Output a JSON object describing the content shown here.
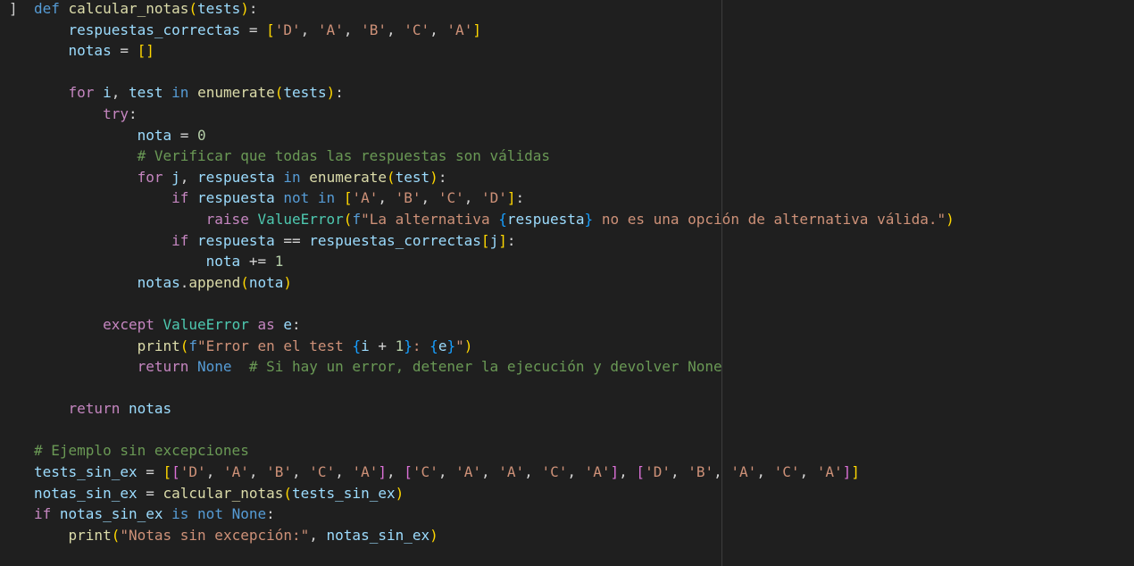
{
  "editor": {
    "fold_marker": "]",
    "lines": [
      [
        [
          "kw",
          "def"
        ],
        [
          "pl",
          " "
        ],
        [
          "fn",
          "calcular_notas"
        ],
        [
          "b1",
          "("
        ],
        [
          "var",
          "tests"
        ],
        [
          "b1",
          ")"
        ],
        [
          "pl",
          ":"
        ]
      ],
      [
        [
          "pl",
          "    "
        ],
        [
          "var",
          "respuestas_correctas"
        ],
        [
          "pl",
          " = "
        ],
        [
          "b1",
          "["
        ],
        [
          "str",
          "'D'"
        ],
        [
          "pl",
          ", "
        ],
        [
          "str",
          "'A'"
        ],
        [
          "pl",
          ", "
        ],
        [
          "str",
          "'B'"
        ],
        [
          "pl",
          ", "
        ],
        [
          "str",
          "'C'"
        ],
        [
          "pl",
          ", "
        ],
        [
          "str",
          "'A'"
        ],
        [
          "b1",
          "]"
        ]
      ],
      [
        [
          "pl",
          "    "
        ],
        [
          "var",
          "notas"
        ],
        [
          "pl",
          " = "
        ],
        [
          "b1",
          "[]"
        ]
      ],
      [],
      [
        [
          "pl",
          "    "
        ],
        [
          "ctl",
          "for"
        ],
        [
          "pl",
          " "
        ],
        [
          "var",
          "i"
        ],
        [
          "pl",
          ", "
        ],
        [
          "var",
          "test"
        ],
        [
          "pl",
          " "
        ],
        [
          "kw",
          "in"
        ],
        [
          "pl",
          " "
        ],
        [
          "fn",
          "enumerate"
        ],
        [
          "b1",
          "("
        ],
        [
          "var",
          "tests"
        ],
        [
          "b1",
          ")"
        ],
        [
          "pl",
          ":"
        ]
      ],
      [
        [
          "pl",
          "        "
        ],
        [
          "ctl",
          "try"
        ],
        [
          "pl",
          ":"
        ]
      ],
      [
        [
          "pl",
          "            "
        ],
        [
          "var",
          "nota"
        ],
        [
          "pl",
          " = "
        ],
        [
          "num",
          "0"
        ]
      ],
      [
        [
          "pl",
          "            "
        ],
        [
          "com",
          "# Verificar que todas las respuestas son válidas"
        ]
      ],
      [
        [
          "pl",
          "            "
        ],
        [
          "ctl",
          "for"
        ],
        [
          "pl",
          " "
        ],
        [
          "var",
          "j"
        ],
        [
          "pl",
          ", "
        ],
        [
          "var",
          "respuesta"
        ],
        [
          "pl",
          " "
        ],
        [
          "kw",
          "in"
        ],
        [
          "pl",
          " "
        ],
        [
          "fn",
          "enumerate"
        ],
        [
          "b1",
          "("
        ],
        [
          "var",
          "test"
        ],
        [
          "b1",
          ")"
        ],
        [
          "pl",
          ":"
        ]
      ],
      [
        [
          "pl",
          "                "
        ],
        [
          "ctl",
          "if"
        ],
        [
          "pl",
          " "
        ],
        [
          "var",
          "respuesta"
        ],
        [
          "pl",
          " "
        ],
        [
          "kw",
          "not"
        ],
        [
          "pl",
          " "
        ],
        [
          "kw",
          "in"
        ],
        [
          "pl",
          " "
        ],
        [
          "b1",
          "["
        ],
        [
          "str",
          "'A'"
        ],
        [
          "pl",
          ", "
        ],
        [
          "str",
          "'B'"
        ],
        [
          "pl",
          ", "
        ],
        [
          "str",
          "'C'"
        ],
        [
          "pl",
          ", "
        ],
        [
          "str",
          "'D'"
        ],
        [
          "b1",
          "]"
        ],
        [
          "pl",
          ":"
        ]
      ],
      [
        [
          "pl",
          "                    "
        ],
        [
          "ctl",
          "raise"
        ],
        [
          "pl",
          " "
        ],
        [
          "cls",
          "ValueError"
        ],
        [
          "b1",
          "("
        ],
        [
          "kw",
          "f"
        ],
        [
          "str",
          "\"La alternativa "
        ],
        [
          "b3",
          "{"
        ],
        [
          "var",
          "respuesta"
        ],
        [
          "b3",
          "}"
        ],
        [
          "str",
          " no es una opción de alternativa válida.\""
        ],
        [
          "b1",
          ")"
        ]
      ],
      [
        [
          "pl",
          "                "
        ],
        [
          "ctl",
          "if"
        ],
        [
          "pl",
          " "
        ],
        [
          "var",
          "respuesta"
        ],
        [
          "pl",
          " == "
        ],
        [
          "var",
          "respuestas_correctas"
        ],
        [
          "b1",
          "["
        ],
        [
          "var",
          "j"
        ],
        [
          "b1",
          "]"
        ],
        [
          "pl",
          ":"
        ]
      ],
      [
        [
          "pl",
          "                    "
        ],
        [
          "var",
          "nota"
        ],
        [
          "pl",
          " += "
        ],
        [
          "num",
          "1"
        ]
      ],
      [
        [
          "pl",
          "            "
        ],
        [
          "var",
          "notas"
        ],
        [
          "pl",
          "."
        ],
        [
          "fn",
          "append"
        ],
        [
          "b1",
          "("
        ],
        [
          "var",
          "nota"
        ],
        [
          "b1",
          ")"
        ]
      ],
      [],
      [
        [
          "pl",
          "        "
        ],
        [
          "ctl",
          "except"
        ],
        [
          "pl",
          " "
        ],
        [
          "cls",
          "ValueError"
        ],
        [
          "pl",
          " "
        ],
        [
          "ctl",
          "as"
        ],
        [
          "pl",
          " "
        ],
        [
          "var",
          "e"
        ],
        [
          "pl",
          ":"
        ]
      ],
      [
        [
          "pl",
          "            "
        ],
        [
          "fn",
          "print"
        ],
        [
          "b1",
          "("
        ],
        [
          "kw",
          "f"
        ],
        [
          "str",
          "\"Error en el test "
        ],
        [
          "b3",
          "{"
        ],
        [
          "var",
          "i"
        ],
        [
          "pl",
          " + "
        ],
        [
          "num",
          "1"
        ],
        [
          "b3",
          "}"
        ],
        [
          "str",
          ": "
        ],
        [
          "b3",
          "{"
        ],
        [
          "var",
          "e"
        ],
        [
          "b3",
          "}"
        ],
        [
          "str",
          "\""
        ],
        [
          "b1",
          ")"
        ]
      ],
      [
        [
          "pl",
          "            "
        ],
        [
          "ctl",
          "return"
        ],
        [
          "pl",
          " "
        ],
        [
          "kw",
          "None"
        ],
        [
          "pl",
          "  "
        ],
        [
          "com",
          "# Si hay un error, detener la ejecución y devolver None"
        ]
      ],
      [],
      [
        [
          "pl",
          "    "
        ],
        [
          "ctl",
          "return"
        ],
        [
          "pl",
          " "
        ],
        [
          "var",
          "notas"
        ]
      ],
      [],
      [
        [
          "com",
          "# Ejemplo sin excepciones"
        ]
      ],
      [
        [
          "var",
          "tests_sin_ex"
        ],
        [
          "pl",
          " = "
        ],
        [
          "b1",
          "["
        ],
        [
          "b2",
          "["
        ],
        [
          "str",
          "'D'"
        ],
        [
          "pl",
          ", "
        ],
        [
          "str",
          "'A'"
        ],
        [
          "pl",
          ", "
        ],
        [
          "str",
          "'B'"
        ],
        [
          "pl",
          ", "
        ],
        [
          "str",
          "'C'"
        ],
        [
          "pl",
          ", "
        ],
        [
          "str",
          "'A'"
        ],
        [
          "b2",
          "]"
        ],
        [
          "pl",
          ", "
        ],
        [
          "b2",
          "["
        ],
        [
          "str",
          "'C'"
        ],
        [
          "pl",
          ", "
        ],
        [
          "str",
          "'A'"
        ],
        [
          "pl",
          ", "
        ],
        [
          "str",
          "'A'"
        ],
        [
          "pl",
          ", "
        ],
        [
          "str",
          "'C'"
        ],
        [
          "pl",
          ", "
        ],
        [
          "str",
          "'A'"
        ],
        [
          "b2",
          "]"
        ],
        [
          "pl",
          ", "
        ],
        [
          "b2",
          "["
        ],
        [
          "str",
          "'D'"
        ],
        [
          "pl",
          ", "
        ],
        [
          "str",
          "'B'"
        ],
        [
          "pl",
          ", "
        ],
        [
          "str",
          "'A'"
        ],
        [
          "pl",
          ", "
        ],
        [
          "str",
          "'C'"
        ],
        [
          "pl",
          ", "
        ],
        [
          "str",
          "'A'"
        ],
        [
          "b2",
          "]"
        ],
        [
          "b1",
          "]"
        ]
      ],
      [
        [
          "var",
          "notas_sin_ex"
        ],
        [
          "pl",
          " = "
        ],
        [
          "fn",
          "calcular_notas"
        ],
        [
          "b1",
          "("
        ],
        [
          "var",
          "tests_sin_ex"
        ],
        [
          "b1",
          ")"
        ]
      ],
      [
        [
          "ctl",
          "if"
        ],
        [
          "pl",
          " "
        ],
        [
          "var",
          "notas_sin_ex"
        ],
        [
          "pl",
          " "
        ],
        [
          "kw",
          "is"
        ],
        [
          "pl",
          " "
        ],
        [
          "kw",
          "not"
        ],
        [
          "pl",
          " "
        ],
        [
          "kw",
          "None"
        ],
        [
          "pl",
          ":"
        ]
      ],
      [
        [
          "pl",
          "    "
        ],
        [
          "fn",
          "print"
        ],
        [
          "b1",
          "("
        ],
        [
          "str",
          "\"Notas sin excepción:\""
        ],
        [
          "pl",
          ", "
        ],
        [
          "var",
          "notas_sin_ex"
        ],
        [
          "b1",
          ")"
        ]
      ]
    ]
  }
}
